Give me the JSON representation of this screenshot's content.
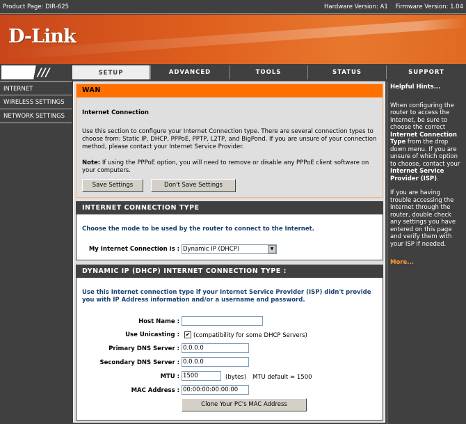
{
  "topbar": {
    "product": "Product Page: DIR-625",
    "hardware": "Hardware Version: A1",
    "firmware": "Firmware Version: 1.04"
  },
  "brand": {
    "logo": "D-Link",
    "color": "#ff7000"
  },
  "nav": {
    "tabs": [
      "SETUP",
      "ADVANCED",
      "TOOLS",
      "STATUS",
      "SUPPORT"
    ],
    "active": "SETUP"
  },
  "sidebar": {
    "items": [
      "INTERNET",
      "WIRELESS SETTINGS",
      "NETWORK SETTINGS"
    ]
  },
  "wan": {
    "title": "WAN",
    "subtitle": "Internet Connection",
    "description": "Use this section to configure your Internet Connection type. There are several connection types to choose from: Static IP, DHCP, PPPoE, PPTP, L2TP, and BigPond. If you are unsure of your connection method, please contact your Internet Service Provider.",
    "note_label": "Note:",
    "note": " If using the PPPoE option, you will need to remove or disable any PPPoE client software on your computers.",
    "save": "Save Settings",
    "dont_save": "Don't Save Settings"
  },
  "conn_type": {
    "title": "INTERNET CONNECTION TYPE",
    "instruction": "Choose the mode to be used by the router to connect to the Internet.",
    "label": "My Internet Connection is :",
    "selected": "Dynamic IP (DHCP)"
  },
  "dhcp": {
    "title": "DYNAMIC IP (DHCP) INTERNET CONNECTION TYPE :",
    "instruction": "Use this Internet connection type if your Internet Service Provider (ISP) didn't provide you with IP Address information and/or a username and password.",
    "host_label": "Host Name :",
    "host_value": "",
    "unicast_label": "Use Unicasting :",
    "unicast_checked": true,
    "unicast_note": "(compatibility for some DHCP Servers)",
    "dns1_label": "Primary DNS Server :",
    "dns1_value": "0.0.0.0",
    "dns2_label": "Secondary DNS Server :",
    "dns2_value": "0.0.0.0",
    "mtu_label": "MTU :",
    "mtu_value": "1500",
    "mtu_unit": "(bytes)",
    "mtu_default": "MTU default = 1500",
    "mac_label": "MAC Address :",
    "mac_value": "00:00:00:00:00:00",
    "clone": "Clone Your PC's MAC Address"
  },
  "hints": {
    "title": "Helpful Hints...",
    "p1a": "When configuring the router to access the Internet, be sure to choose the correct ",
    "p1b": "Internet Connection Type",
    "p1c": " from the drop down menu. If you are unsure of which option to choose, contact your ",
    "p1d": "Internet Service Provider (ISP)",
    "p1e": ".",
    "p2": "If you are having trouble accessing the Internet through the router, double check any settings you have entered on this page and verify them with your ISP if needed.",
    "more": "More..."
  }
}
